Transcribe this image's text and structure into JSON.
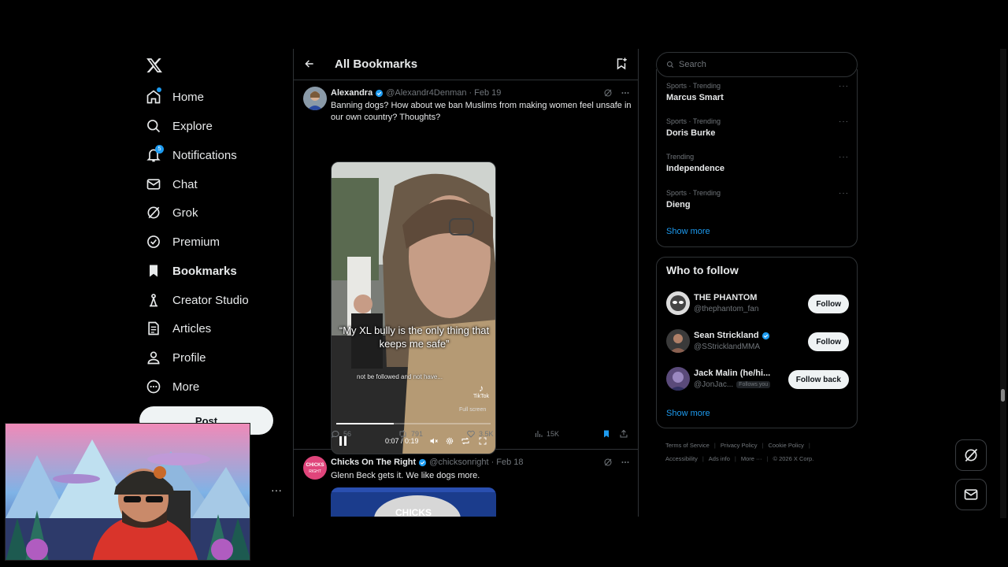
{
  "nav": {
    "items": [
      {
        "label": "Home",
        "icon": "home-icon"
      },
      {
        "label": "Explore",
        "icon": "search-icon"
      },
      {
        "label": "Notifications",
        "icon": "bell-icon",
        "badge": "5"
      },
      {
        "label": "Chat",
        "icon": "mail-icon"
      },
      {
        "label": "Grok",
        "icon": "grok-icon"
      },
      {
        "label": "Premium",
        "icon": "premium-icon"
      },
      {
        "label": "Bookmarks",
        "icon": "bookmark-icon"
      },
      {
        "label": "Creator Studio",
        "icon": "creator-studio-icon"
      },
      {
        "label": "Articles",
        "icon": "articles-icon"
      },
      {
        "label": "Profile",
        "icon": "person-icon"
      },
      {
        "label": "More",
        "icon": "more-circle-icon"
      }
    ],
    "post_label": "Post",
    "more_dots": "···"
  },
  "header": {
    "title": "All Bookmarks"
  },
  "tweets": [
    {
      "name": "Alexandra",
      "handle": "@Alexandr4Denman",
      "date": "Feb 19",
      "text": "Banning dogs? How about we ban Muslims from making women feel unsafe in our own country? Thoughts?",
      "video": {
        "caption": "“My XL bully is the only thing that keeps me safe”",
        "subcaption": "not be followed and not have...",
        "brand": "TikTok",
        "fullscreen_label": "Full screen",
        "time": "0:07 / 0:19",
        "progress": 0.37
      },
      "replies": "56",
      "reposts": "791",
      "likes": "3.5K",
      "views": "15K"
    },
    {
      "name": "Chicks On The Right",
      "handle": "@chicksonright",
      "date": "Feb 18",
      "text": "Glenn Beck gets it. We like dogs more.",
      "video_label": "CHICKS"
    }
  ],
  "search": {
    "placeholder": "Search"
  },
  "trends": [
    {
      "meta": "Sports · Trending",
      "name": "Marcus Smart"
    },
    {
      "meta": "Sports · Trending",
      "name": "Doris Burke"
    },
    {
      "meta": "Trending",
      "name": "Independence"
    },
    {
      "meta": "Sports · Trending",
      "name": "Dieng"
    }
  ],
  "trends_show_more": "Show more",
  "who_to_follow": {
    "title": "Who to follow",
    "accounts": [
      {
        "name": "THE PHANTOM",
        "handle": "@thephantom_fan",
        "button": "Follow",
        "verified": false
      },
      {
        "name": "Sean Strickland",
        "handle": "@SStricklandMMA",
        "button": "Follow",
        "verified": true
      },
      {
        "name": "Jack Malin (he/hi...",
        "handle": "@JonJac...",
        "follows_you": "Follows you",
        "button": "Follow back",
        "verified": false
      }
    ],
    "show_more": "Show more"
  },
  "footer": {
    "row1": [
      "Terms of Service",
      "Privacy Policy",
      "Cookie Policy"
    ],
    "row2": [
      "Accessibility",
      "Ads info",
      "More ···",
      "© 2026 X Corp."
    ]
  },
  "colors": {
    "accent": "#1d9bf0",
    "background": "#000000",
    "border": "#2f3336",
    "muted": "#71767b"
  }
}
